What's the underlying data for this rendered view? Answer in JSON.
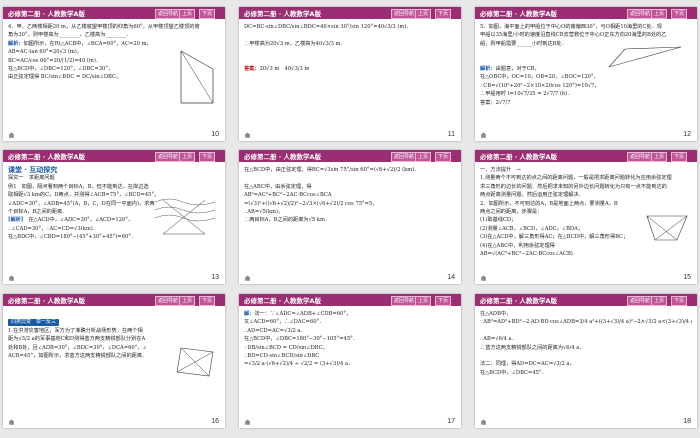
{
  "header": {
    "title": "必修第二册 · 人教数学A版",
    "back": "返回导航",
    "prev": "上页",
    "next": "下页"
  },
  "slides": [
    {
      "page": "10",
      "lines": [
        "4．甲、乙两楼相距20 m，从乙楼底望甲楼顶的仰角为60°，从甲楼顶望乙楼顶的俯",
        "角为30°，则甲楼高为________，乙楼高为________．",
        "解析：如图所示，在Rt△ACB中，∠BCA=60°，AC=20 m，",
        "AB=AC·tan 60°=20√3 (m)，",
        "BC=AC/cos 60°=20/(1/2)=40 (m)．",
        "在△BCD中，∠DBC=120°，∠DBC=30°，",
        "由正弦定理得 BC/sin∠BDC = DC/sin∠DBC，"
      ],
      "hl": "解析："
    },
    {
      "page": "11",
      "lines": [
        "DC=BC·sin∠DBC/sin∠BDC=40×sin 30°/sin 120°=40√3/3 (m)．",
        "",
        "∴甲楼高为20√3 m，乙楼高为40√3/3 m．",
        "",
        "",
        "答案：20√3 m　40√3/3 m"
      ],
      "hl": "答案："
    },
    {
      "page": "12",
      "lines": [
        "5．如图，海平面上的甲船位于中心O的南偏西30°，与O相距10海里的C处．现",
        "甲船以35海里/小时的速度沿直线CB去营救位于中心O正东方向20海里的B处的乙",
        "船，则甲船需要______小时到达B处．",
        "",
        "",
        "解析：由题意，对于CB，",
        "在△OBC中，OC=10，OB=20，∠BOC=120°，",
        "∴CB=√(10²+20²−2×10×20cos 120°)=10√7，",
        "∴甲船用时 t=10√7/35 = 2√7/7 (h)．",
        "答案：2√7/7"
      ],
      "hl": "解析："
    },
    {
      "page": "13",
      "lines": [
        "课堂 · 互动探究",
        "探究一　求距离问题",
        "例1　如图，隔河看到两个目标A，B，但不能到达，在岸边选",
        "取相距√3 km的C，D两点，并测得∠ACB=75°，∠BCD=45°，",
        "∠ADC=30°，∠ADB=45°(A，B，C，D在同一平面内)，求两",
        "个目标A，B之间的距离．",
        "[解析]　在△ACD中，∠ADC=30°，∠ACD=120°，",
        "∴∠CAD=30°，∴AC=CD=√3(km)．",
        "在△BDC中，∠CBD=180°−(45°+30°+45°)=60°．"
      ],
      "hl": "[解析]"
    },
    {
      "page": "14",
      "lines": [
        "在△BCD中，由正弦定理，得BC=√3sin 75°/sin 60°=(√6+√2)/2 (km)．",
        "",
        "在△ABC中，由余弦定理，得",
        "AB²=AC²+BC²−2AC·BCcos∠BCA",
        "=(√3)²+((√6+√2)/2)²−2√3×(√6+√2)/2 cos 75°=5，",
        "∴AB=√5(km)，",
        "∴两目标A，B之间的距离为√5 km．"
      ],
      "hl": ""
    },
    {
      "page": "15",
      "lines": [
        "一、方法提升　→",
        "1.测量两个不可到达的点之间的距离问题，一般是把求距离问题转化为应用余弦定理",
        "求三角形的边长的问题．然后把求未知的另外边长问题转化为只有一点不能到达的",
        "两点距离测量问题，然后运用正弦定理解决．",
        "2．如图所示，不可到达的A，B是地面上两点，要测量A，B",
        "两点之间的距离，步骤是：",
        "(1)取基线CD；",
        "(2)测量∠ACB，∠BCD，∠ADC，∠BDA；",
        "(3)在△ACD中，解三角形得AC；在△BCD中，解三角形得BC；",
        "(4)在△ABC中，利用余弦定理得",
        "AB=√(AC²+BC²−2AC·BCcos∠ACB)．"
      ],
      "hl": ""
    },
    {
      "page": "16",
      "lines": [
        "",
        "同类异变　举一反三",
        "1.在洪涝灾害地区，军方为了准确分析战场形势，在两个相",
        "距为√3/2 a的军事基地C和D测得蓝方两支精锐部队分别在A",
        "处和B处，且∠ADB=30°，∠BDC=30°，∠DCA=60°，∠",
        "ACB=45°，如图所示，求蓝方这两支精锐部队之间的距离．"
      ],
      "hl": ""
    },
    {
      "page": "17",
      "lines": [
        "解：法一：∵∠ADC=∠ADB+∠CDB=60°，",
        "又∠ACD=60°，∴∠DAC=60°．",
        "∴AD=CD=AC=√3/2 a．",
        "在△BCD中，∠DBC=180°−30°−105°=45°．",
        "∵DB/sin∠BCD = CD/sin∠DBC，",
        "∴BD=CD·sin∠BCD/sin∠DBC",
        "=√3/2 a·(√6+√2)/4 ÷ √2/2 = (3+√3)/4 a．"
      ],
      "hl": "解："
    },
    {
      "page": "18",
      "lines": [
        "在△ADB中，",
        "∵AB²=AD²+BD²−2·AD·BD·cos∠ADB=3/4 a²+((3+√3)/4 a)²−2×√3/2 a×(3+√3)/4 a×√3/2=3/8 a²，",
        "",
        "∴AB=√6/4 a．",
        "∴蓝方这两支精锐部队之间的距离为√6/4 a．",
        "",
        "法二：同理，得AD=DC=AC=√3/2 a，",
        "在△BCD中，∠DBC=45°．"
      ],
      "hl": ""
    }
  ]
}
